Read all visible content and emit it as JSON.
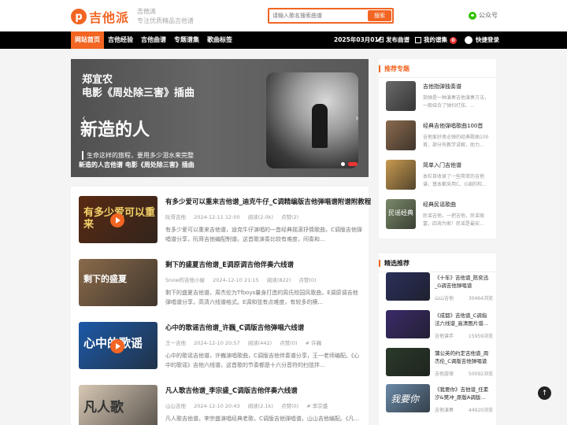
{
  "header": {
    "logo_letter": "p",
    "logo_text": "吉他派",
    "site_name": "吉他派",
    "slogan": "专注优质精品吉他谱",
    "search_placeholder": "请输入歌名搜索曲谱",
    "search_button": "搜索",
    "wechat_label": "公众号"
  },
  "nav": {
    "items": [
      "网站首页",
      "吉他经验",
      "吉他曲谱",
      "专题谱集",
      "歌曲标签"
    ],
    "date": "2025年03月01日",
    "publish": "发布曲谱",
    "my_scores": "我的谱集",
    "my_scores_count": "0",
    "login": "快捷登录"
  },
  "banner": {
    "title_line1": "郑宜农",
    "title_line2": "电影《周处除三害》插曲",
    "big_text": "新造的人",
    "lyric": "生命这样的旅程，要用多少泪水来完整",
    "caption": "新造的人吉他谱 电影《周处除三害》插曲"
  },
  "articles": [
    {
      "title": "有多少爱可以重来吉他谱_迪克牛仔_C调精编版吉他弹唱谱附谱附教程",
      "author": "阮哥吉他",
      "date": "2024-12-11 12:00",
      "views": "阅读(2.0k)",
      "likes": "点赞(2)",
      "excerpt": "有多少爱可以重来吉他谱，迪克牛仔演唱的一首经典摇滚抒情歌曲，C调版吉他弹唱谱分享，阮哥吉他编配制谱。这首歌演奏比较有难度，间奏和...",
      "thumb_text": "有多少爱可以重来",
      "thumb_color": "#5a2a12"
    },
    {
      "title": "剩下的盛夏吉他谱_E调原调吉他伴奏六线谱",
      "author": "Snow的吉他小屋",
      "date": "2024-12-10 21:15",
      "views": "阅读(822)",
      "likes": "点赞(0)",
      "excerpt": "剩下的盛夏吉他谱，周杰伦为Tfboys量身打造的周氏校园风歌曲，E调原调吉他弹唱谱分享，高清六线谱格式。E调和弦有点难度，有较多的横...",
      "thumb_text": "剩下的盛夏",
      "thumb_color": "#8a6a4a"
    },
    {
      "title": "心中的歌谣吉他谱_许巍_C调版吉他弹唱六线谱",
      "author": "王一吉他",
      "date": "2024-12-10 20:57",
      "views": "阅读(442)",
      "likes": "点赞(0)",
      "tag": "# 许巍",
      "excerpt": "心中的歌谣吉他谱，许巍演唱歌曲，C调版吉他伴奏谱分享，王一老师编配。《心中的歌谣》吉他六线谱，这首歌的节奏都是十六分音符的扫弦拌...",
      "thumb_text": "心中的歌谣",
      "thumb_color": "#1d5aa8"
    },
    {
      "title": "凡人歌吉他谱_李宗盛_C调版吉他伴奏六线谱",
      "author": "山山吉他",
      "date": "2024-12-10 20:43",
      "views": "阅读(2.1k)",
      "likes": "点赞(0)",
      "tag": "# 李宗盛",
      "excerpt": "凡人歌吉他谱，李宗盛演唱经典老歌，C调版吉他弹唱谱，山山吉他编配。《凡...",
      "thumb_text": "凡人歌",
      "thumb_color": "#d8c8b4"
    }
  ],
  "topics_title": "推荐专题",
  "topics": [
    {
      "title": "吉他指弹独奏谱",
      "desc": "指弹是一种演奏吉他演奏方法，一般结合了弹扫打弦、...",
      "color": "#6a6a6a"
    },
    {
      "title": "经典吉他弹唱歌曲100首",
      "desc": "吉他爱好者必弹的经典歌曲100首，部分有教学讲解，助力...",
      "color": "#8a6a4e"
    },
    {
      "title": "简单入门吉他谱",
      "desc": "本栏目收录了一些简单的吉他谱，基本都采用C、G调的和...",
      "color": "#c89a50"
    },
    {
      "title": "经典民谣歌曲",
      "desc": "民谣吉他，一把吉他，民谣很富，四海为家！民谣是最安...",
      "color": "#7a8a6a",
      "thumb_text": "民谣经典"
    }
  ],
  "picks_title": "精选推荐",
  "picks": [
    {
      "title": "《十年》吉他谱_陈奕迅_G调吉他弹唱谱",
      "author": "山山吉他",
      "views": "30464浏览",
      "color": "#2a2f5a"
    },
    {
      "title": "《成都》吉他谱_C调指法六线谱_高清图片谱...",
      "author": "吉他谱手",
      "views": "15959浏览",
      "color": "#3a2a6a"
    },
    {
      "title": "蒲公英的约定吉他谱_周杰伦_C调版吉他弹唱谱",
      "author": "吉他旋律",
      "views": "50092浏览",
      "color": "#2a3a2a"
    },
    {
      "title": "《我要你》吉他谱_任素汐&樊冲_原版A调版...",
      "author": "吉他演奏",
      "views": "44920浏览",
      "color": "#6a8aa8",
      "thumb_text": "我要你"
    }
  ],
  "to_top": "↑"
}
